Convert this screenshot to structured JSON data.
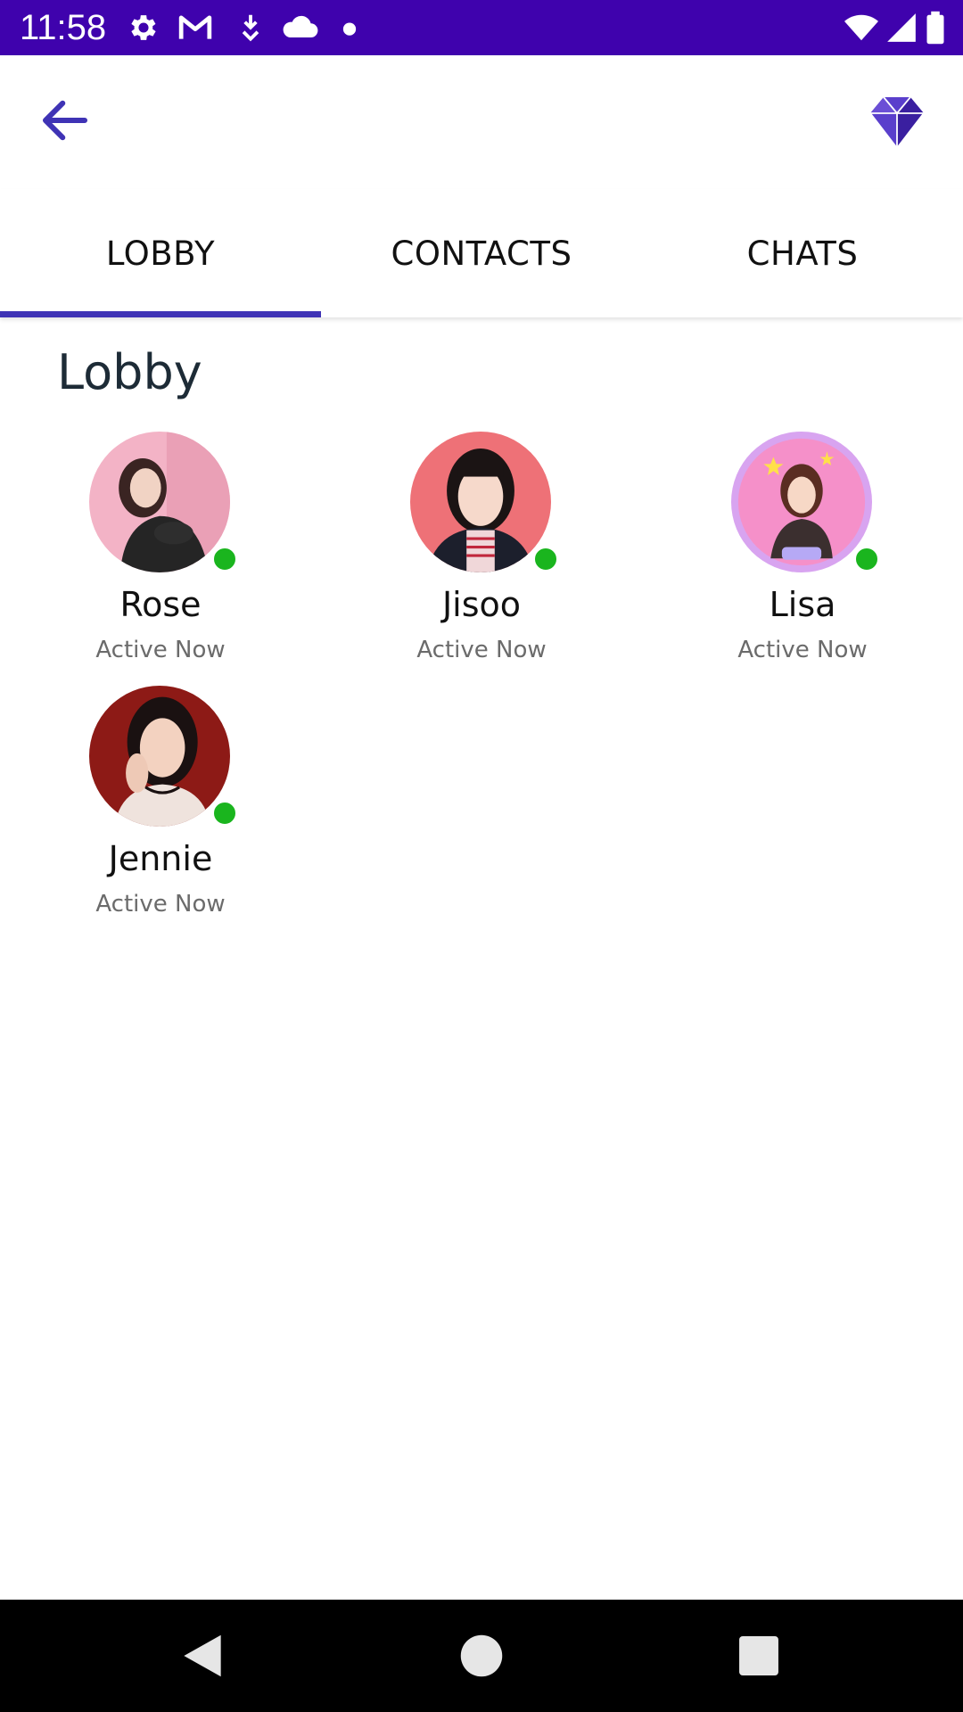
{
  "status_bar": {
    "time": "11:58",
    "icons": [
      "settings-icon",
      "gmail-icon",
      "download-icon",
      "cloud-icon",
      "dot-icon",
      "wifi-icon",
      "signal-icon",
      "battery-icon"
    ],
    "background": "#3f02ad"
  },
  "app_bar": {
    "back_icon": "arrow-back-icon",
    "premium_icon": "diamond-icon",
    "accent": "#3f33b5"
  },
  "tabs": [
    {
      "label": "LOBBY",
      "selected": true
    },
    {
      "label": "CONTACTS",
      "selected": false
    },
    {
      "label": "CHATS",
      "selected": false
    }
  ],
  "lobby": {
    "title": "Lobby",
    "contacts": [
      {
        "name": "Rose",
        "status": "Active Now",
        "online": true
      },
      {
        "name": "Jisoo",
        "status": "Active Now",
        "online": true
      },
      {
        "name": "Lisa",
        "status": "Active Now",
        "online": true
      },
      {
        "name": "Jennie",
        "status": "Active Now",
        "online": true
      }
    ]
  },
  "nav_bar": {
    "icons": [
      "back-triangle-icon",
      "home-circle-icon",
      "recents-square-icon"
    ]
  }
}
